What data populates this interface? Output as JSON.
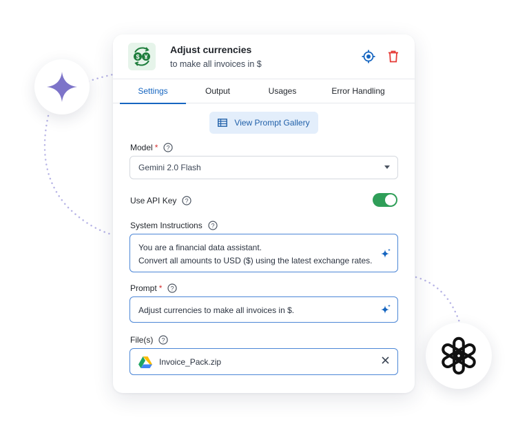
{
  "decorations": {
    "left_badge_icon": "gemini-sparkle-icon",
    "right_badge_icon": "openai-logo-icon",
    "sparkle_color": "#7d74c9",
    "dotted_line_color": "#b7b4e6"
  },
  "header": {
    "icon": "currency-exchange-icon",
    "icon_symbols": [
      "$",
      "¥"
    ],
    "title": "Adjust currencies",
    "subtitle": "to make all invoices in $",
    "actions": [
      "target-icon",
      "trash-icon"
    ]
  },
  "tabs": [
    {
      "label": "Settings",
      "active": true
    },
    {
      "label": "Output",
      "active": false
    },
    {
      "label": "Usages",
      "active": false
    },
    {
      "label": "Error Handling",
      "active": false
    }
  ],
  "gallery_button": {
    "label": "View Prompt Gallery",
    "icon": "table-icon"
  },
  "model": {
    "label": "Model",
    "required": "*",
    "value": "Gemini 2.0 Flash"
  },
  "api_key": {
    "label": "Use API Key",
    "enabled": true
  },
  "system_instructions": {
    "label": "System Instructions",
    "line1": "You are a financial data assistant.",
    "line2": "Convert all amounts to USD ($) using the latest exchange rates."
  },
  "prompt": {
    "label": "Prompt",
    "required": "*",
    "value": "Adjust currencies to make all invoices in $."
  },
  "files": {
    "label": "File(s)",
    "file_name": "Invoice_Pack.zip",
    "source_icon": "google-drive-icon"
  },
  "colors": {
    "accent": "#1565c0",
    "toggle_on": "#2f9e58",
    "delete": "#e53935",
    "required": "#d32f2f"
  }
}
